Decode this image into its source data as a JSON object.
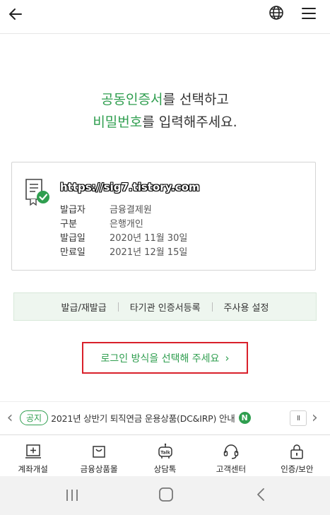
{
  "header": {
    "back_icon": "arrow-left-icon",
    "globe_icon": "globe-icon",
    "menu_icon": "hamburger-menu-icon"
  },
  "instruction": {
    "line1_highlight": "공동인증서",
    "line1_rest": "를 선택하고",
    "line2_highlight": "비밀번호",
    "line2_rest": "를 입력해주세요."
  },
  "certificate": {
    "name": "https://sig7.tistory.com",
    "icon": "certificate-check-icon",
    "rows": [
      {
        "label": "발급자",
        "value": "금융결제원"
      },
      {
        "label": "구분",
        "value": "은행개인"
      },
      {
        "label": "발급일",
        "value": "2020년 11월 30일"
      },
      {
        "label": "만료일",
        "value": "2021년 12월 15일"
      }
    ]
  },
  "actions": {
    "issue": "발급/재발급",
    "other_register": "타기관 인증서등록",
    "main_use": "주사용 설정"
  },
  "login_method": {
    "label": "로그인 방식을 선택해 주세요",
    "chevron": "›"
  },
  "notice": {
    "badge": "공지",
    "text": "2021년 상반기 퇴직연금 운용상품(DC&IRP) 안내",
    "new_badge": "N",
    "pause": "II",
    "prev": "‹",
    "next": "›"
  },
  "bottom_nav": [
    {
      "label": "계좌개설",
      "icon": "account-open-icon"
    },
    {
      "label": "금융상품몰",
      "icon": "shopping-bag-icon"
    },
    {
      "label": "상담톡",
      "icon": "chat-bot-icon"
    },
    {
      "label": "고객센터",
      "icon": "headset-icon"
    },
    {
      "label": "인증/보안",
      "icon": "lock-icon"
    }
  ],
  "colors": {
    "accent": "#2f9e4f",
    "highlight_border": "#d9202b",
    "action_bar_bg": "#eef6ef"
  }
}
